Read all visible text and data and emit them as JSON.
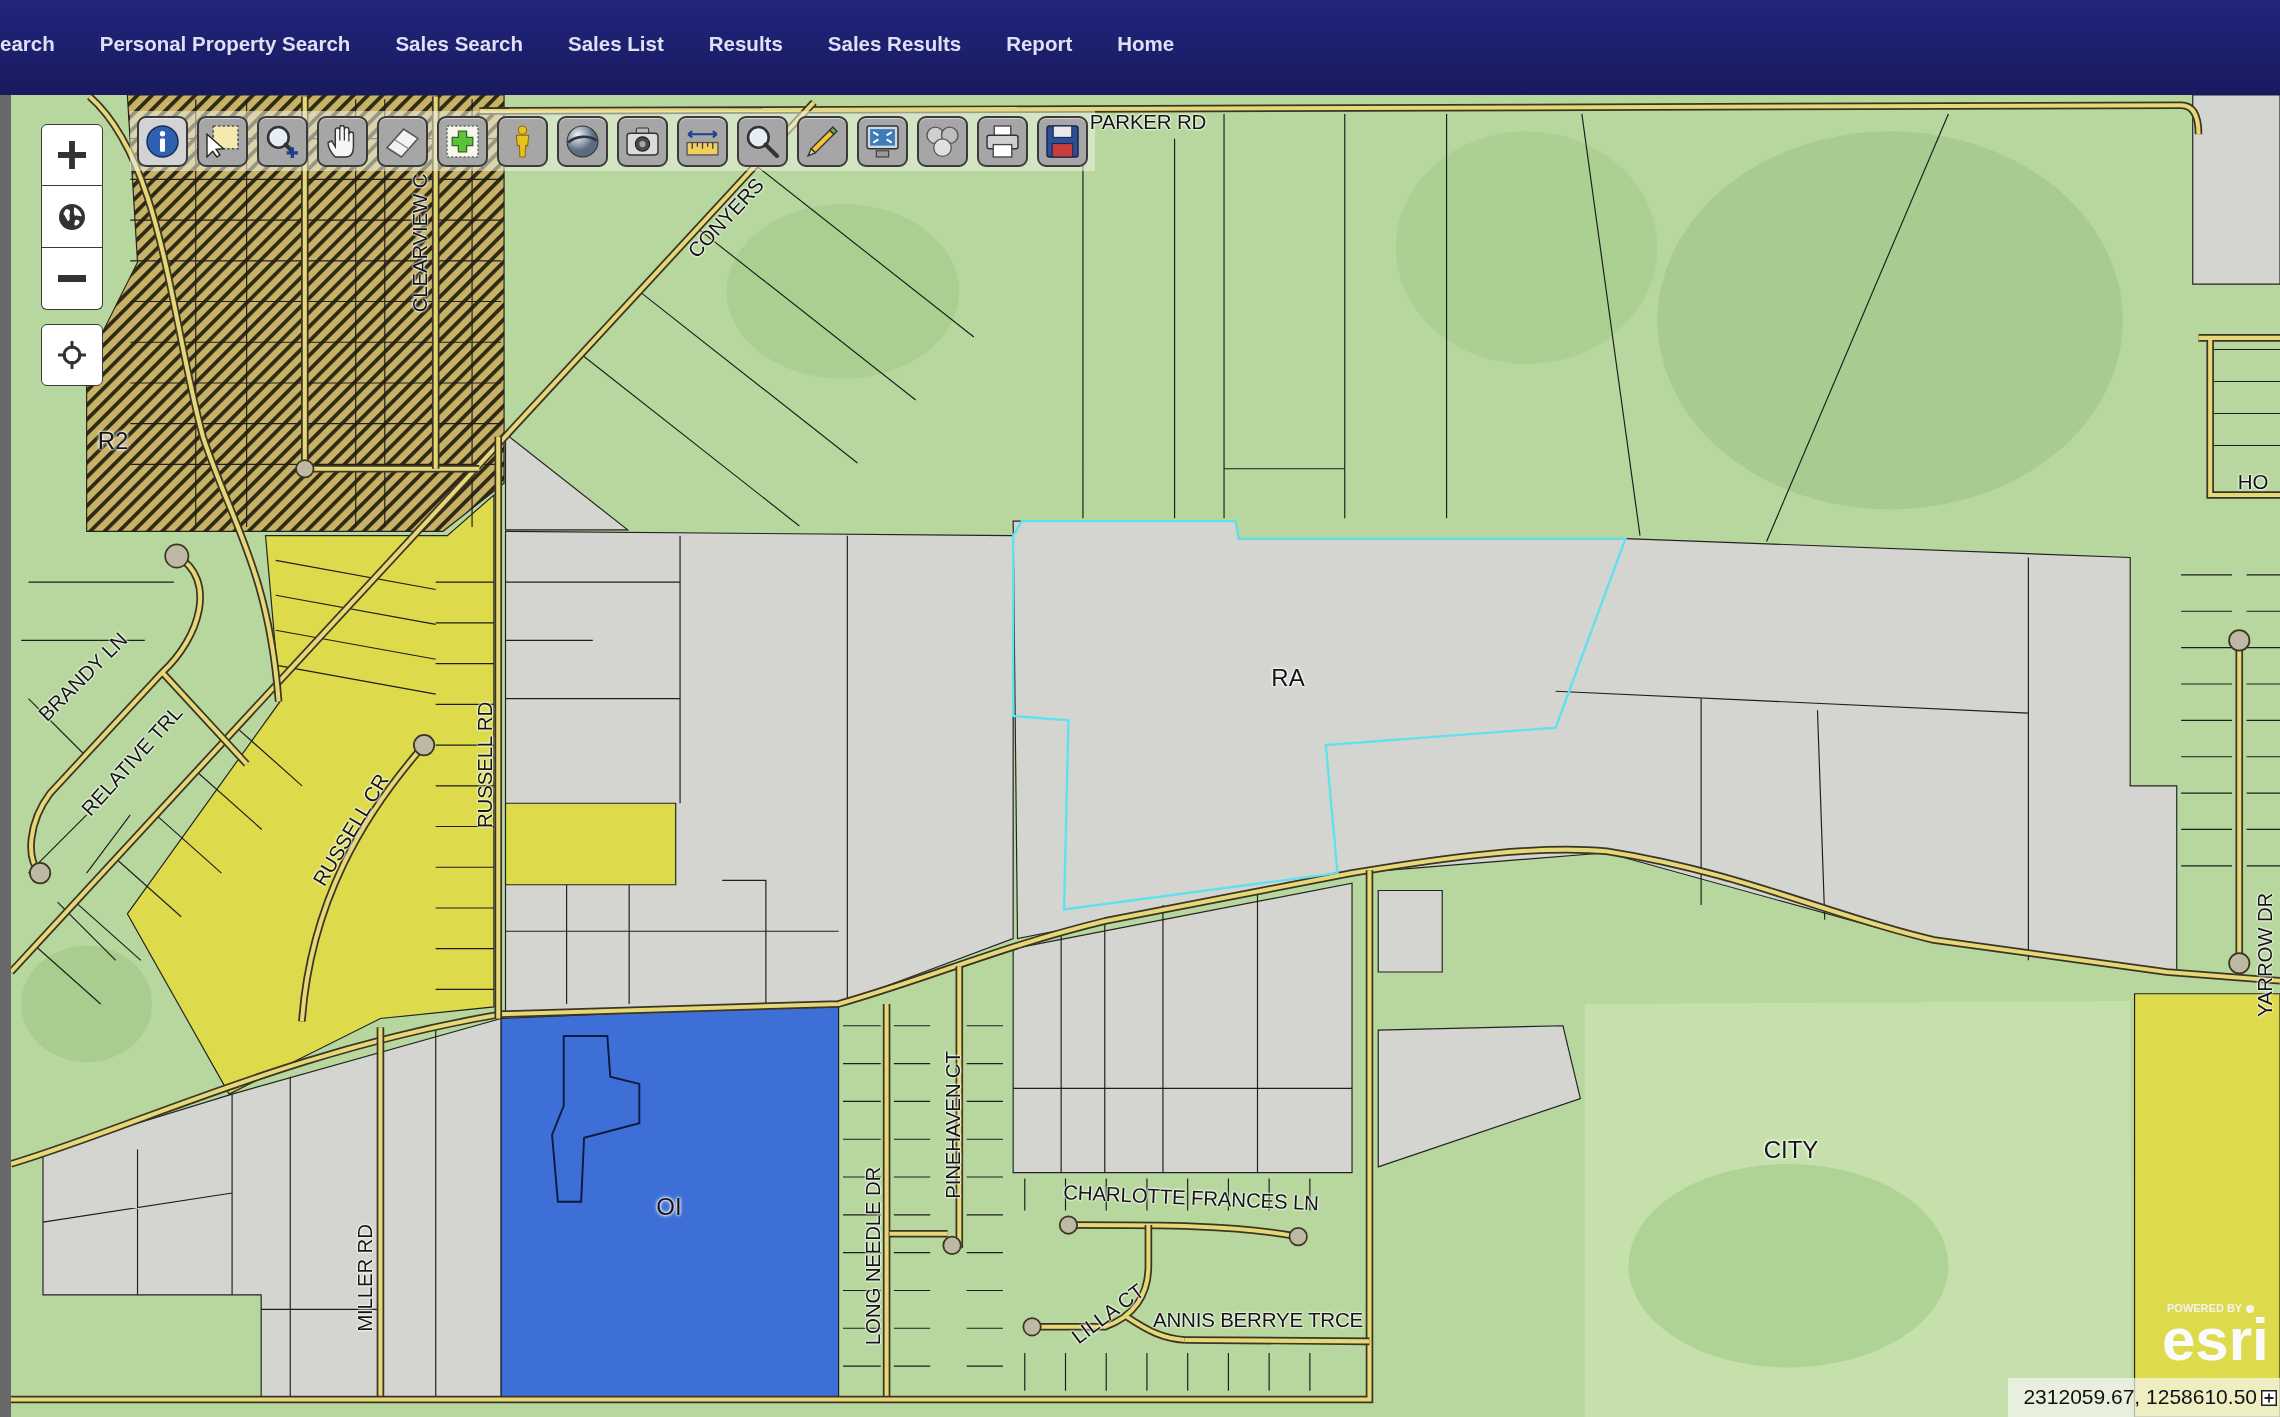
{
  "nav": {
    "items": [
      {
        "label": "earch"
      },
      {
        "label": "Personal Property Search"
      },
      {
        "label": "Sales Search"
      },
      {
        "label": "Sales List"
      },
      {
        "label": "Results"
      },
      {
        "label": "Sales Results"
      },
      {
        "label": "Report"
      },
      {
        "label": "Home"
      }
    ]
  },
  "map": {
    "controls": [
      {
        "kind": "zoomin"
      },
      {
        "kind": "extent"
      },
      {
        "kind": "zoomout"
      },
      {
        "kind": "locate"
      }
    ],
    "toolbar": [
      {
        "kind": "info",
        "selected": true
      },
      {
        "kind": "select",
        "selected": false
      },
      {
        "kind": "zoomin",
        "selected": false
      },
      {
        "kind": "pan",
        "selected": false
      },
      {
        "kind": "erase",
        "selected": false
      },
      {
        "kind": "add",
        "selected": false
      },
      {
        "kind": "person",
        "selected": false
      },
      {
        "kind": "sphere",
        "selected": false
      },
      {
        "kind": "camera",
        "selected": false
      },
      {
        "kind": "measure",
        "selected": false
      },
      {
        "kind": "find",
        "selected": false
      },
      {
        "kind": "draw",
        "selected": false
      },
      {
        "kind": "fullextent",
        "selected": false
      },
      {
        "kind": "cluster",
        "selected": false
      },
      {
        "kind": "print",
        "selected": false
      },
      {
        "kind": "save",
        "selected": false
      }
    ],
    "road_labels": [
      "PARKER RD",
      "CONYERS",
      "CLEARVIEW C",
      "HO",
      "BRANDY LN",
      "RELATIVE TRL",
      "RUSSELL CR",
      "RUSSELL RD",
      "YARROW DR",
      "PINEHAVEN CT",
      "MILLER RD",
      "LONG NEEDLE DR",
      "CHARLOTTE FRANCES LN",
      "LILLA CT",
      "ANNIS BERRYE TRCE"
    ],
    "zone_labels": [
      "R2",
      "RA",
      "CITY",
      "OI"
    ],
    "attribution": {
      "prefix": "POWERED BY",
      "brand": "esri"
    },
    "coordinates": "2312059.67, 1258610.50"
  }
}
